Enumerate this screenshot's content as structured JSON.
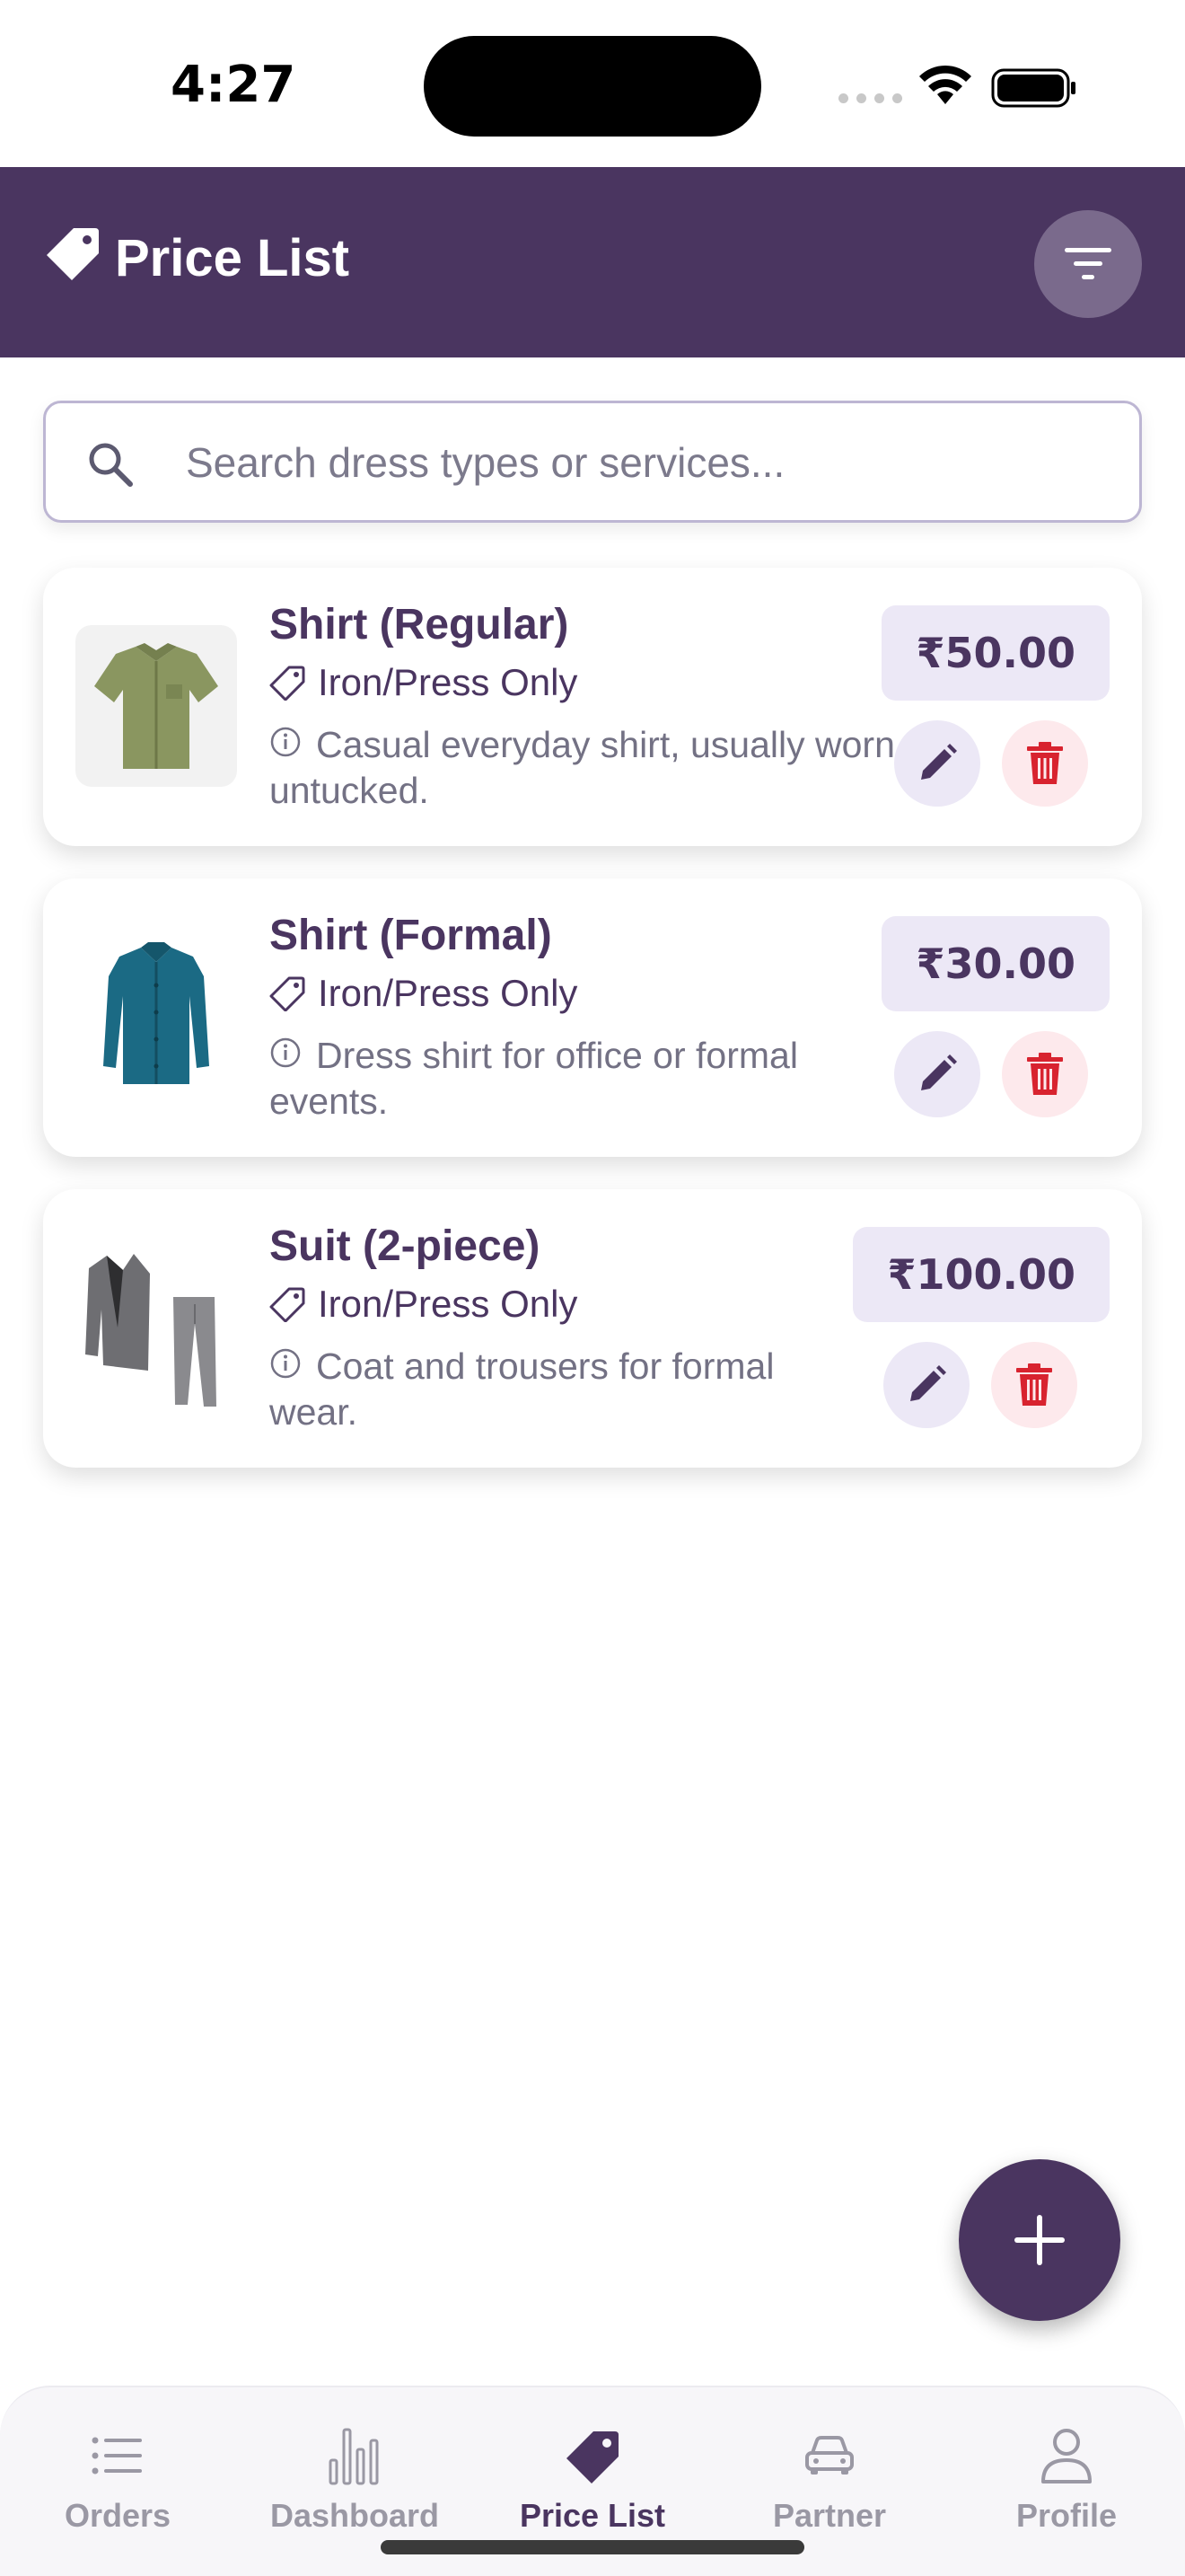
{
  "status_bar": {
    "time": "4:27"
  },
  "header": {
    "title": "Price List"
  },
  "search": {
    "placeholder": "Search dress types or services..."
  },
  "items": [
    {
      "name": "Shirt (Regular)",
      "service": "Iron/Press Only",
      "description": "Casual everyday shirt, usually worn untucked.",
      "price": "₹50.00"
    },
    {
      "name": "Shirt (Formal)",
      "service": "Iron/Press Only",
      "description": "Dress shirt for office or formal events.",
      "price": "₹30.00"
    },
    {
      "name": "Suit (2-piece)",
      "service": "Iron/Press Only",
      "description": "Coat and trousers for formal wear.",
      "price": "₹100.00"
    }
  ],
  "nav": [
    {
      "label": "Orders",
      "icon": "list-icon",
      "active": false
    },
    {
      "label": "Dashboard",
      "icon": "bar-chart-icon",
      "active": false
    },
    {
      "label": "Price List",
      "icon": "tag-icon",
      "active": true
    },
    {
      "label": "Partner",
      "icon": "car-icon",
      "active": false
    },
    {
      "label": "Profile",
      "icon": "person-icon",
      "active": false
    }
  ],
  "colors": {
    "primary": "#4a3560",
    "price_bg": "#ece8f6",
    "delete_bg": "#fde9ec",
    "delete_icon": "#d8232f",
    "inactive_nav": "#9a98a4"
  }
}
